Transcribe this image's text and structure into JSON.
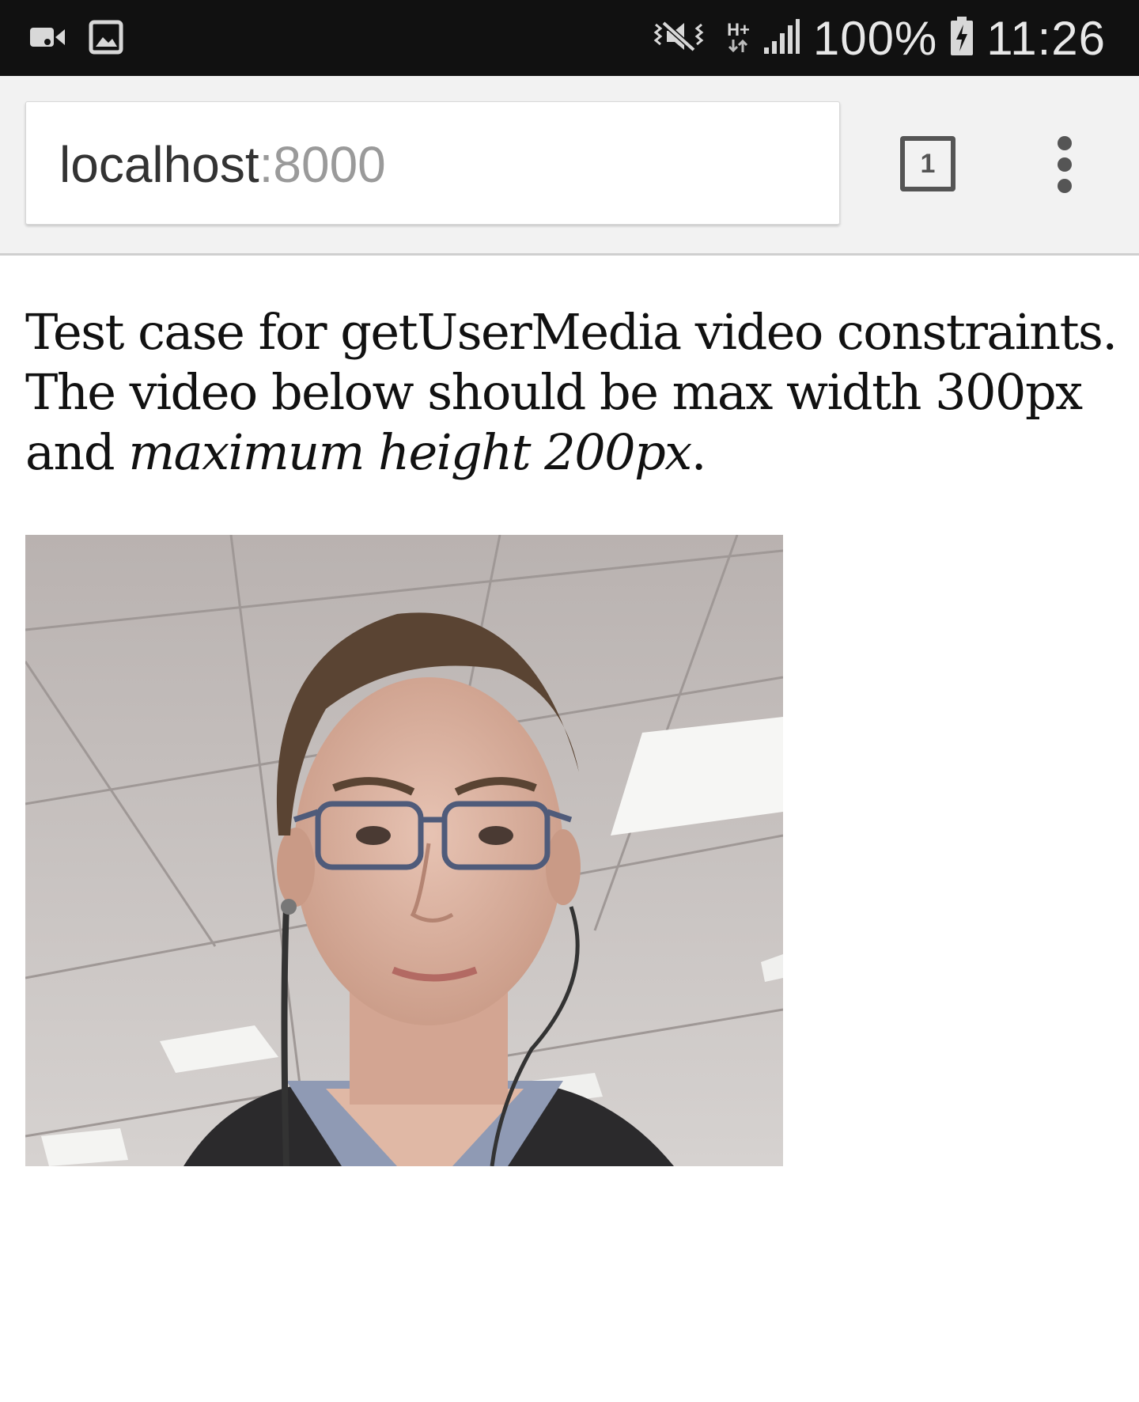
{
  "status_bar": {
    "battery_percent": "100%",
    "time": "11:26",
    "network_type": "H+",
    "icons": [
      "video-camera-icon",
      "image-icon",
      "vibrate-mute-icon",
      "network-arrows-icon",
      "signal-icon",
      "battery-charging-icon"
    ]
  },
  "browser": {
    "url_host": "localhost",
    "url_port": ":8000",
    "tab_count": "1",
    "menu_icon": "more-vertical-icon"
  },
  "page": {
    "line1": "Test case for getUserMedia video constraints.",
    "line2_prefix": "The video below should be max width 300px",
    "line2_and": "and",
    "emphasis": "maximum height 200px",
    "line2_end": "."
  },
  "video": {
    "subject": "webcam video frame"
  },
  "colors": {
    "status_bar_bg": "#111111",
    "toolbar_bg": "#f2f2f2",
    "url_host": "#333333",
    "url_port": "#9a9a9a"
  }
}
